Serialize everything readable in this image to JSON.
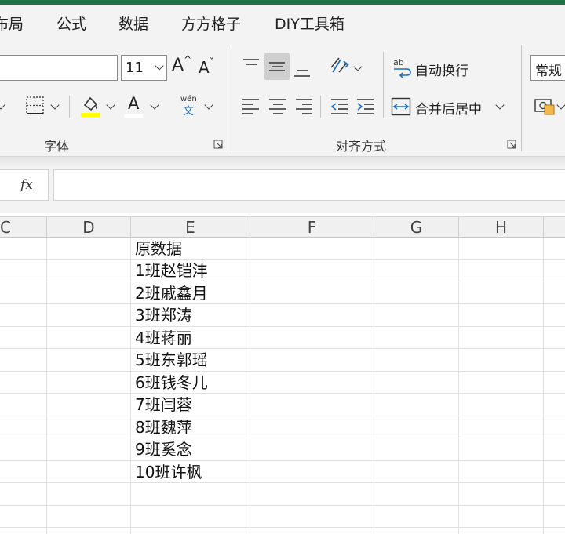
{
  "menu": {
    "tabs": [
      "布局",
      "公式",
      "数据",
      "方方格子",
      "DIY工具箱"
    ]
  },
  "ribbon": {
    "font_group": {
      "label": "字体",
      "font_name": "",
      "font_size": "11",
      "grow_font_glyph": "A",
      "shrink_font_glyph": "A",
      "font_color_glyph": "A",
      "phonetic_top": "wén",
      "phonetic_bottom": "文",
      "fill_color": "#ffff00",
      "font_color": "#000000"
    },
    "alignment_group": {
      "label": "对齐方式",
      "wrap_text": "自动换行",
      "merge_center": "合并后居中"
    },
    "number_group": {
      "format": "常规"
    }
  },
  "formula_bar": {
    "fx": "fx",
    "value": ""
  },
  "grid": {
    "columns": [
      "C",
      "D",
      "E",
      "F",
      "G",
      "H"
    ],
    "column_e_cells": [
      "原数据",
      "1班赵铠沣",
      "2班戚鑫月",
      "3班郑涛",
      "4班蒋丽",
      "5班东郭瑶",
      "6班钱冬儿",
      "7班闫蓉",
      "8班魏萍",
      "9班奚念",
      "10班许枫"
    ]
  },
  "colors": {
    "excel_green": "#217346",
    "ribbon_bg": "#f3f3f3",
    "gridline": "#e1e1e1",
    "accent_blue": "#1e6fc2"
  }
}
